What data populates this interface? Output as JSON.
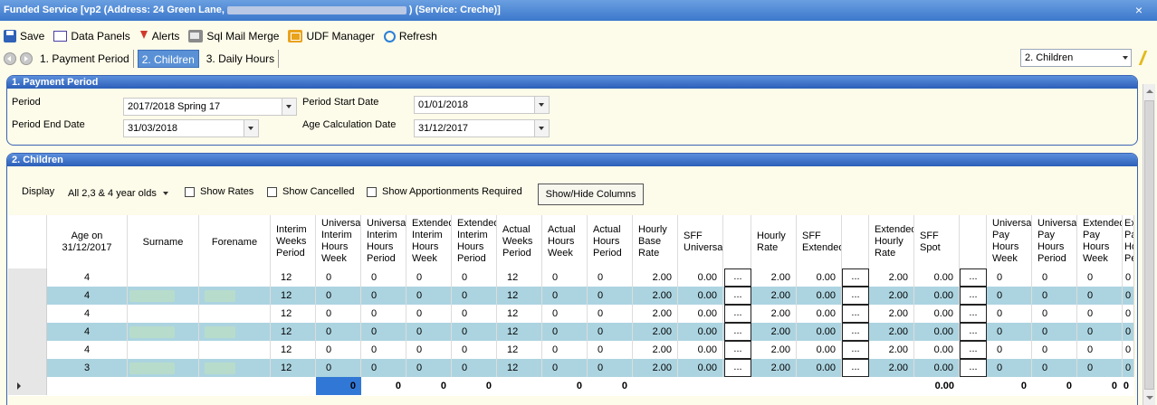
{
  "window": {
    "title_prefix": "Funded Service [vp2 (Address: 24 Green Lane,",
    "title_suffix": ") (Service: Creche)]",
    "close_label": "×"
  },
  "toolbar": {
    "save": "Save",
    "data_panels": "Data Panels",
    "alerts": "Alerts",
    "sql_mail_merge": "Sql Mail Merge",
    "udf_manager": "UDF Manager",
    "refresh": "Refresh"
  },
  "tabs": [
    "1. Payment Period",
    "2. Children",
    "3. Daily Hours"
  ],
  "panel_selector": "2. Children",
  "payment_period": {
    "title": "1. Payment Period",
    "period_label": "Period",
    "period_value": "2017/2018 Spring 17",
    "period_start_label": "Period Start Date",
    "period_start_value": "01/01/2018",
    "period_end_label": "Period End Date",
    "period_end_value": "31/03/2018",
    "age_calc_label": "Age Calculation Date",
    "age_calc_value": "31/12/2017"
  },
  "children": {
    "title": "2. Children",
    "display_label": "Display",
    "display_value": "All 2,3 & 4 year olds",
    "show_rates": "Show Rates",
    "show_cancelled": "Show Cancelled",
    "show_apportionments": "Show Apportionments Required",
    "show_hide_columns": "Show/Hide Columns"
  },
  "grid": {
    "headers": {
      "age": "Age on\n31/12/2017",
      "surname": "Surname",
      "forename": "Forename",
      "interim_weeks": "Interim\nWeeks\nPeriod",
      "universal_interim_week": "Universal\nInterim\nHours\nWeek",
      "universal_interim_period": "Universal\nInterim\nHours\nPeriod",
      "extended_interim_week": "Extended\nInterim\nHours\nWeek",
      "extended_interim_period": "Extended\nInterim\nHours\nPeriod",
      "actual_weeks": "Actual\nWeeks\nPeriod",
      "actual_hours_week": "Actual\nHours\nWeek",
      "actual_hours_period": "Actual\nHours\nPeriod",
      "hourly_base_rate": "Hourly\nBase\nRate",
      "sff_universal": "SFF\nUniversal",
      "hourly_rate": "Hourly\nRate",
      "sff_extended": "SFF\nExtended",
      "extended_hourly_rate": "Extended\nHourly\nRate",
      "sff_spot": "SFF\nSpot",
      "universal_pay_week": "Universal\nPay\nHours\nWeek",
      "universal_pay_period": "Universal\nPay\nHours\nPeriod",
      "extended_pay_week": "Extended\nPay\nHours\nWeek",
      "extended_pay_period": "Extended\nPay\nHours\nPeriod"
    },
    "ellipsis": "...",
    "rows": [
      {
        "age": "4",
        "interim_weeks": "12",
        "uiw": "0",
        "uip": "0",
        "eiw": "0",
        "eip": "0",
        "actual_weeks": "12",
        "ahw": "0",
        "ahp": "0",
        "base_rate": "2.00",
        "sff_universal": "0.00",
        "hourly_rate": "2.00",
        "sff_extended": "0.00",
        "ext_rate": "2.00",
        "sff_spot": "0.00",
        "upw": "0",
        "upp": "0",
        "epw": "0",
        "epp": "0"
      },
      {
        "age": "4",
        "interim_weeks": "12",
        "uiw": "0",
        "uip": "0",
        "eiw": "0",
        "eip": "0",
        "actual_weeks": "12",
        "ahw": "0",
        "ahp": "0",
        "base_rate": "2.00",
        "sff_universal": "0.00",
        "hourly_rate": "2.00",
        "sff_extended": "0.00",
        "ext_rate": "2.00",
        "sff_spot": "0.00",
        "upw": "0",
        "upp": "0",
        "epw": "0",
        "epp": "0"
      },
      {
        "age": "4",
        "interim_weeks": "12",
        "uiw": "0",
        "uip": "0",
        "eiw": "0",
        "eip": "0",
        "actual_weeks": "12",
        "ahw": "0",
        "ahp": "0",
        "base_rate": "2.00",
        "sff_universal": "0.00",
        "hourly_rate": "2.00",
        "sff_extended": "0.00",
        "ext_rate": "2.00",
        "sff_spot": "0.00",
        "upw": "0",
        "upp": "0",
        "epw": "0",
        "epp": "0"
      },
      {
        "age": "4",
        "interim_weeks": "12",
        "uiw": "0",
        "uip": "0",
        "eiw": "0",
        "eip": "0",
        "actual_weeks": "12",
        "ahw": "0",
        "ahp": "0",
        "base_rate": "2.00",
        "sff_universal": "0.00",
        "hourly_rate": "2.00",
        "sff_extended": "0.00",
        "ext_rate": "2.00",
        "sff_spot": "0.00",
        "upw": "0",
        "upp": "0",
        "epw": "0",
        "epp": "0"
      },
      {
        "age": "4",
        "interim_weeks": "12",
        "uiw": "0",
        "uip": "0",
        "eiw": "0",
        "eip": "0",
        "actual_weeks": "12",
        "ahw": "0",
        "ahp": "0",
        "base_rate": "2.00",
        "sff_universal": "0.00",
        "hourly_rate": "2.00",
        "sff_extended": "0.00",
        "ext_rate": "2.00",
        "sff_spot": "0.00",
        "upw": "0",
        "upp": "0",
        "epw": "0",
        "epp": "0"
      },
      {
        "age": "3",
        "interim_weeks": "12",
        "uiw": "0",
        "uip": "0",
        "eiw": "0",
        "eip": "0",
        "actual_weeks": "12",
        "ahw": "0",
        "ahp": "0",
        "base_rate": "2.00",
        "sff_universal": "0.00",
        "hourly_rate": "2.00",
        "sff_extended": "0.00",
        "ext_rate": "2.00",
        "sff_spot": "0.00",
        "upw": "0",
        "upp": "0",
        "epw": "0",
        "epp": "0"
      }
    ],
    "totals": {
      "uiw": "0",
      "uip": "0",
      "eiw": "0",
      "eip": "0",
      "ahw": "0",
      "ahp": "0",
      "sff_spot": "0.00",
      "upw": "0",
      "upp": "0",
      "epw": "0",
      "epp": "0"
    }
  },
  "colors": {
    "title_bar": "#3c78cc",
    "row_alt": "#acd4e0",
    "active_tab": "#5a91d6",
    "panel_bg": "#fdfbe9"
  },
  "icons": [
    "save-icon",
    "data-panels-icon",
    "alerts-icon",
    "sql-mail-merge-icon",
    "udf-manager-icon",
    "refresh-icon",
    "lightning-icon"
  ]
}
